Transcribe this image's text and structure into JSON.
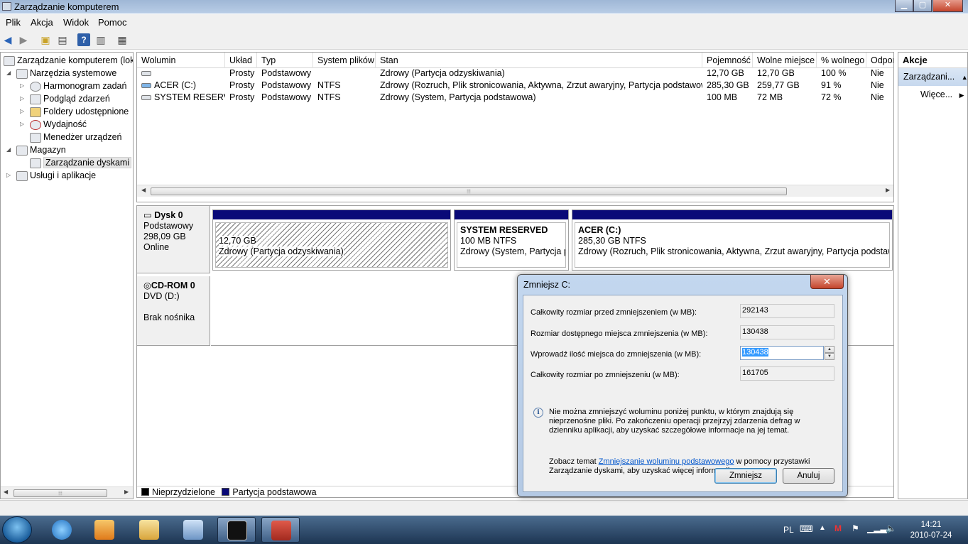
{
  "window": {
    "title": "Zarządzanie komputerem",
    "minimize": "▁",
    "maximize": "▢",
    "close": "✕"
  },
  "menu": [
    "Plik",
    "Akcja",
    "Widok",
    "Pomoc"
  ],
  "tree": {
    "root": "Zarządzanie komputerem (loka",
    "system_tools": "Narzędzia systemowe",
    "task_scheduler": "Harmonogram zadań",
    "event_viewer": "Podgląd zdarzeń",
    "shared_folders": "Foldery udostępnione",
    "performance": "Wydajność",
    "device_manager": "Menedżer urządzeń",
    "storage": "Magazyn",
    "disk_management": "Zarządzanie dyskami",
    "services": "Usługi i aplikacje"
  },
  "volumes": {
    "headers": [
      "Wolumin",
      "Układ",
      "Typ",
      "System plików",
      "Stan",
      "Pojemność",
      "Wolne miejsce",
      "% wolnego",
      "Odpor"
    ],
    "rows": [
      [
        "",
        "Prosty",
        "Podstawowy",
        "",
        "Zdrowy (Partycja odzyskiwania)",
        "12,70 GB",
        "12,70 GB",
        "100 %",
        "Nie"
      ],
      [
        "ACER (C:)",
        "Prosty",
        "Podstawowy",
        "NTFS",
        "Zdrowy (Rozruch, Plik stronicowania, Aktywna, Zrzut awaryjny, Partycja podstawowa)",
        "285,30 GB",
        "259,77 GB",
        "91 %",
        "Nie"
      ],
      [
        "SYSTEM RESERVED",
        "Prosty",
        "Podstawowy",
        "NTFS",
        "Zdrowy (System, Partycja podstawowa)",
        "100 MB",
        "72 MB",
        "72 %",
        "Nie"
      ]
    ]
  },
  "disk0": {
    "name": "Dysk 0",
    "type": "Podstawowy",
    "size": "298,09 GB",
    "status": "Online",
    "partitions": [
      {
        "title": "",
        "size": "12,70 GB",
        "state": "Zdrowy (Partycja odzyskiwania)"
      },
      {
        "title": "SYSTEM RESERVED",
        "size": "100 MB NTFS",
        "state": "Zdrowy (System, Partycja po"
      },
      {
        "title": "ACER  (C:)",
        "size": "285,30 GB NTFS",
        "state": "Zdrowy (Rozruch, Plik stronicowania, Aktywna, Zrzut awaryjny, Partycja podstaw"
      }
    ]
  },
  "cdrom0": {
    "name": "CD-ROM 0",
    "drive": "DVD (D:)",
    "status": "Brak nośnika"
  },
  "legend": {
    "unallocated": "Nieprzydzielone",
    "primary": "Partycja podstawowa",
    "unallocated_color": "#000000",
    "primary_color": "#0a0a78"
  },
  "actions": {
    "header": "Akcje",
    "section": "Zarządzani...",
    "more": "Więce..."
  },
  "dialog": {
    "title": "Zmniejsz C:",
    "total_before_label": "Całkowity rozmiar przed zmniejszeniem (w MB):",
    "total_before_value": "292143",
    "available_label": "Rozmiar dostępnego miejsca zmniejszenia (w MB):",
    "available_value": "130438",
    "enter_label": "Wprowadź ilość miejsca do zmniejszenia (w MB):",
    "enter_value": "130438",
    "total_after_label": "Całkowity rozmiar po zmniejszeniu (w MB):",
    "total_after_value": "161705",
    "info": "Nie można zmniejszyć woluminu poniżej punktu, w którym znajdują się nieprzenośne pliki. Po zakończeniu operacji przejrzyj zdarzenia defrag w dzienniku aplikacji, aby uzyskać szczegółowe informacje na jej temat.",
    "see_prefix": "Zobacz temat ",
    "see_link": "Zmniejszanie woluminu podstawowego",
    "see_suffix": " w pomocy przystawki Zarządzanie dyskami, aby uzyskać więcej informacji.",
    "ok": "Zmniejsz",
    "cancel": "Anuluj"
  },
  "taskbar": {
    "lang": "PL",
    "time": "14:21",
    "date": "2010-07-24"
  }
}
